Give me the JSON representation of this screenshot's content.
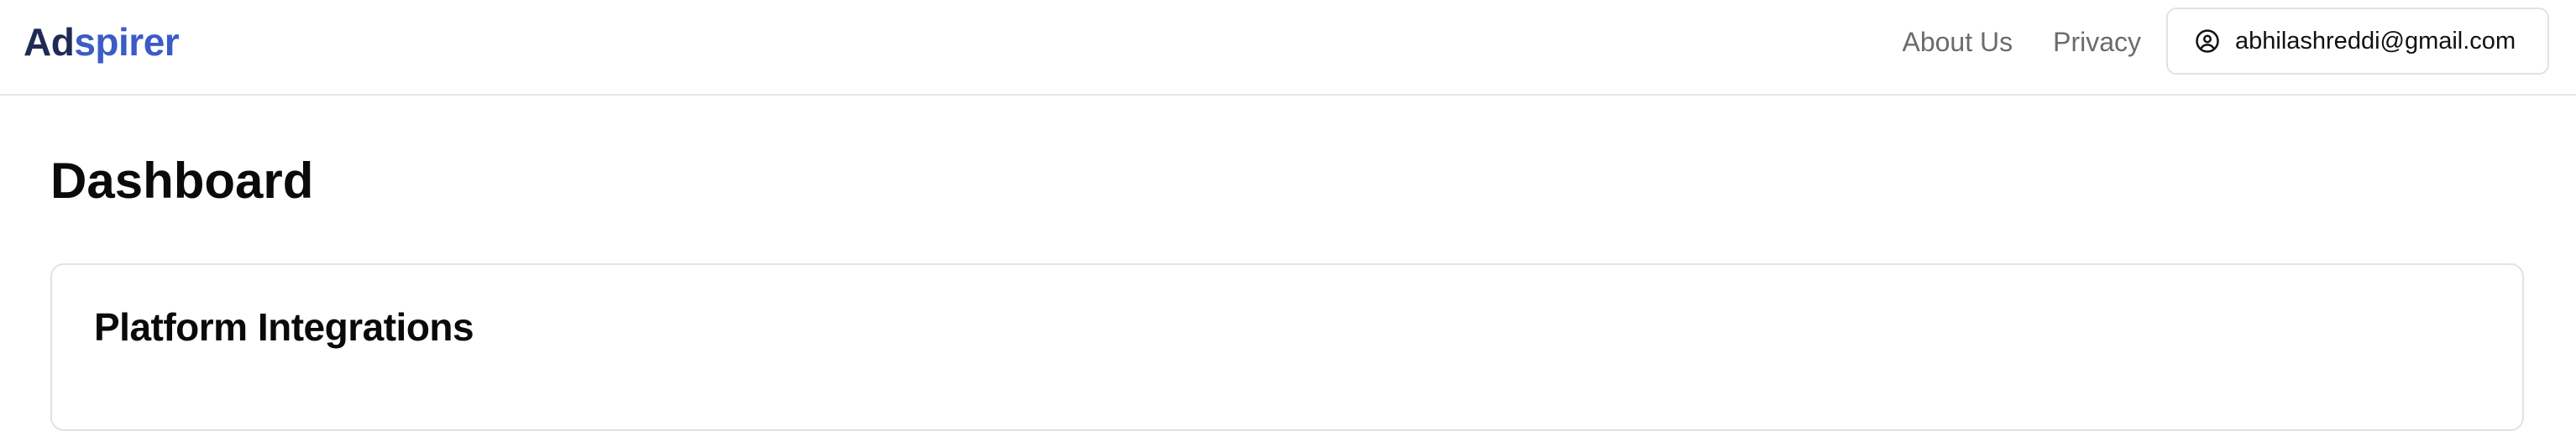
{
  "brand": {
    "part1": "Ad",
    "part2": "spirer"
  },
  "nav": {
    "about_label": "About Us",
    "privacy_label": "Privacy"
  },
  "user": {
    "email": "abhilashreddi@gmail.com",
    "icon": "user-circle-icon"
  },
  "page": {
    "title": "Dashboard"
  },
  "integrations_card": {
    "title": "Platform Integrations"
  },
  "colors": {
    "brand_dark": "#1f2a56",
    "brand_blue": "#3b5cc6",
    "nav_text": "#6b6b6b",
    "border": "#e2e2e2"
  }
}
